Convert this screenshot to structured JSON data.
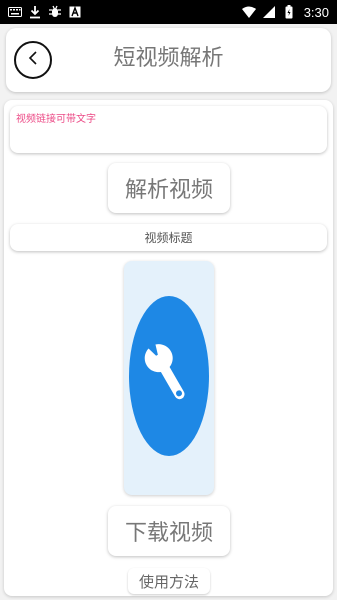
{
  "status_bar": {
    "time": "3:30",
    "left_icons": [
      "keyboard-icon",
      "download-icon",
      "bug-icon",
      "text-a-icon"
    ],
    "right_icons": [
      "wifi-icon",
      "signal-icon",
      "battery-icon"
    ]
  },
  "header": {
    "title": "短视频解析"
  },
  "main": {
    "url_placeholder": "视频链接可带文字",
    "parse_label": "解析视频",
    "video_title": "视频标题",
    "download_label": "下载视频",
    "usage_label": "使用方法"
  },
  "colors": {
    "placeholder": "#ec4a86",
    "thumb_bg": "#e4f1fb",
    "logo_blue": "#1e88e5"
  }
}
